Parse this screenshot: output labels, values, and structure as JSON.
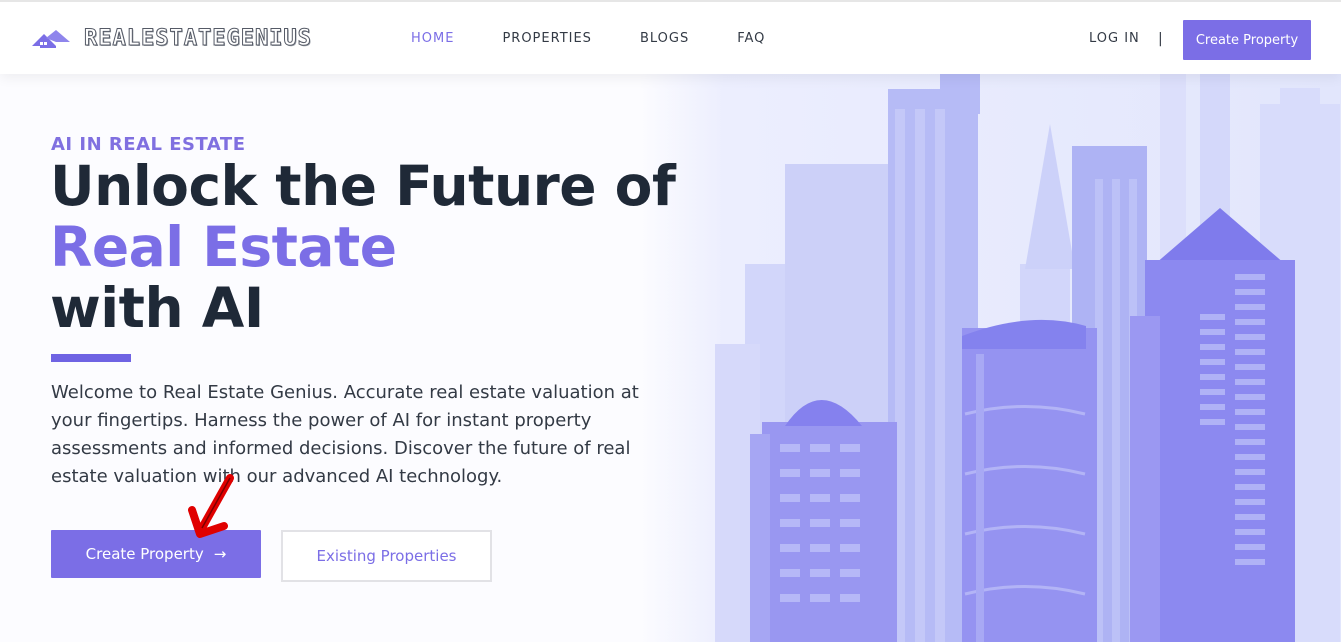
{
  "brand": {
    "name": "REALESTATEGENIUS",
    "color": "#7b6ee6"
  },
  "nav": {
    "links": [
      "HOME",
      "PROPERTIES",
      "BLOGS",
      "FAQ"
    ],
    "active": "HOME",
    "login_label": "LOG IN",
    "separator": "|",
    "cta_label": "Create Property"
  },
  "hero": {
    "eyebrow": "AI IN REAL ESTATE",
    "title_line1": "Unlock the Future of",
    "title_accent": "Real Estate",
    "title_line3": "with AI",
    "description": "Welcome to Real Estate Genius. Accurate real estate valuation at your fingertips. Harness the power of AI for instant property assessments and informed decisions. Discover the future of real estate valuation with our advanced AI technology.",
    "primary_button": "Create Property",
    "primary_arrow": "→",
    "secondary_button": "Existing Properties"
  },
  "colors": {
    "accent": "#7b6ee6",
    "text": "#1f2937",
    "annotation": "#e00000"
  }
}
